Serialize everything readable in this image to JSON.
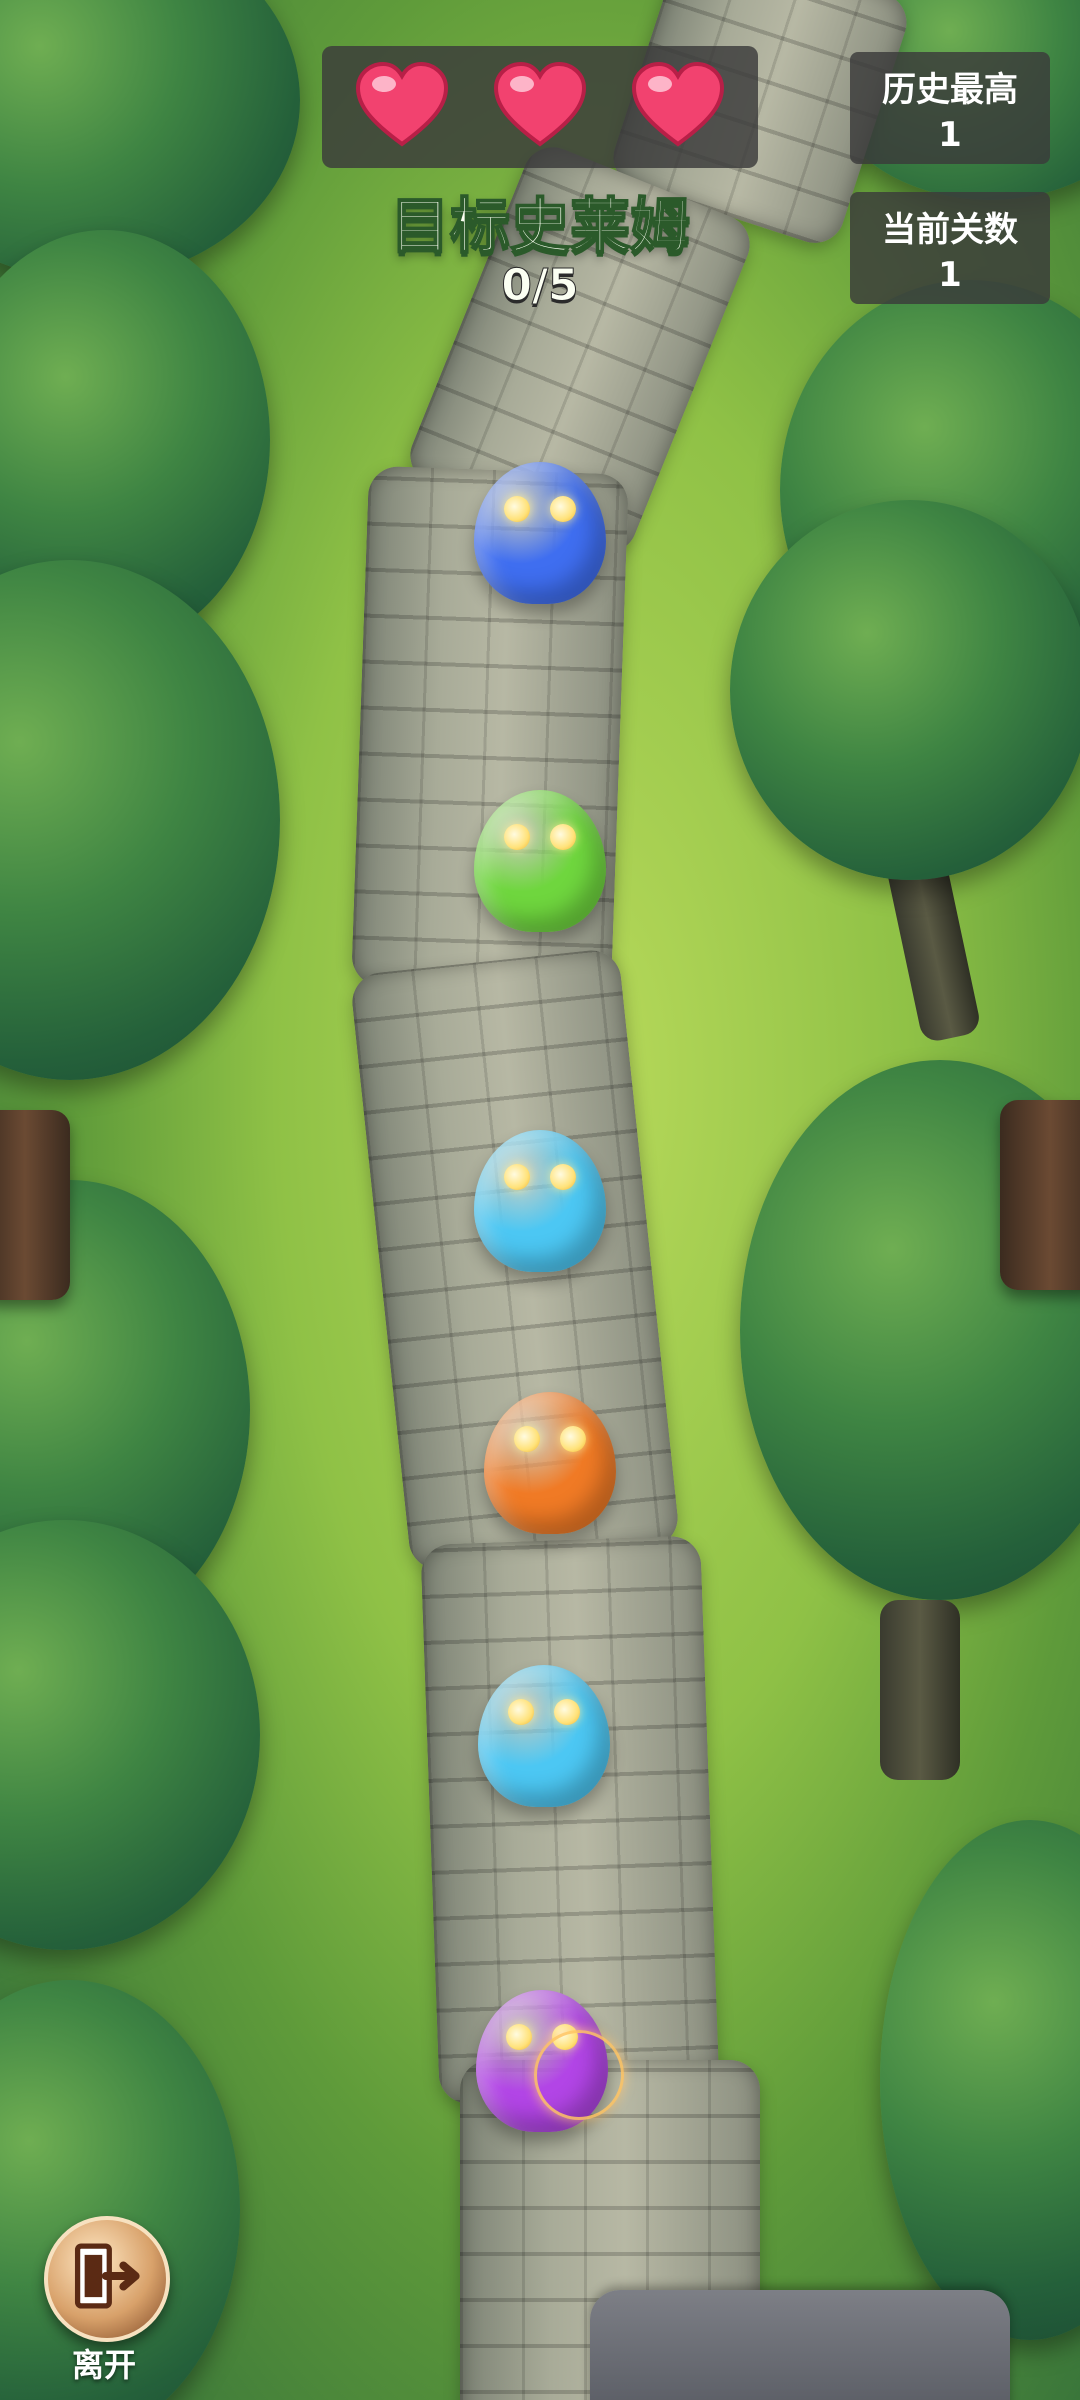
{
  "hud": {
    "lives": 3,
    "target_label": "目标史莱姆",
    "target_progress": "0/5",
    "best_score": {
      "label": "历史最高",
      "value": "1"
    },
    "current_level": {
      "label": "当前关数",
      "value": "1"
    }
  },
  "exit_button": {
    "label": "离开",
    "icon": "exit-door-icon"
  },
  "slimes": [
    {
      "color": "blue",
      "hex": "#3f6ef0"
    },
    {
      "color": "green",
      "hex": "#6fd63e"
    },
    {
      "color": "cyan",
      "hex": "#4cc7f3"
    },
    {
      "color": "orange",
      "hex": "#f07a25"
    },
    {
      "color": "cyan",
      "hex": "#4cc7f3"
    },
    {
      "color": "purple",
      "hex": "#b245e6"
    }
  ],
  "colors": {
    "heart": "#f2426f",
    "hud_background": "#3a3a3a",
    "title_fill": "#fbfff2",
    "title_outline": "#2b5a2a"
  }
}
